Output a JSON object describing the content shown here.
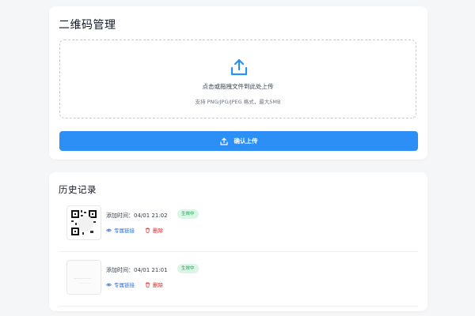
{
  "upload": {
    "title": "二维码管理",
    "dropzone_title": "点击或拖拽文件到此处上传",
    "dropzone_hint": "支持 PNG/JPG/JPEG 格式，最大5MB",
    "confirm_label": "确认上传",
    "accent_color": "#2b8ff5"
  },
  "history": {
    "title": "历史记录",
    "items": [
      {
        "added_time": "添加时间：04/01 21:02",
        "status": "生效中",
        "link_label": "专属链接",
        "delete_label": "删除"
      },
      {
        "added_time": "添加时间：04/01 21:01",
        "status": "生效中",
        "link_label": "专属链接",
        "delete_label": "删除"
      }
    ]
  }
}
